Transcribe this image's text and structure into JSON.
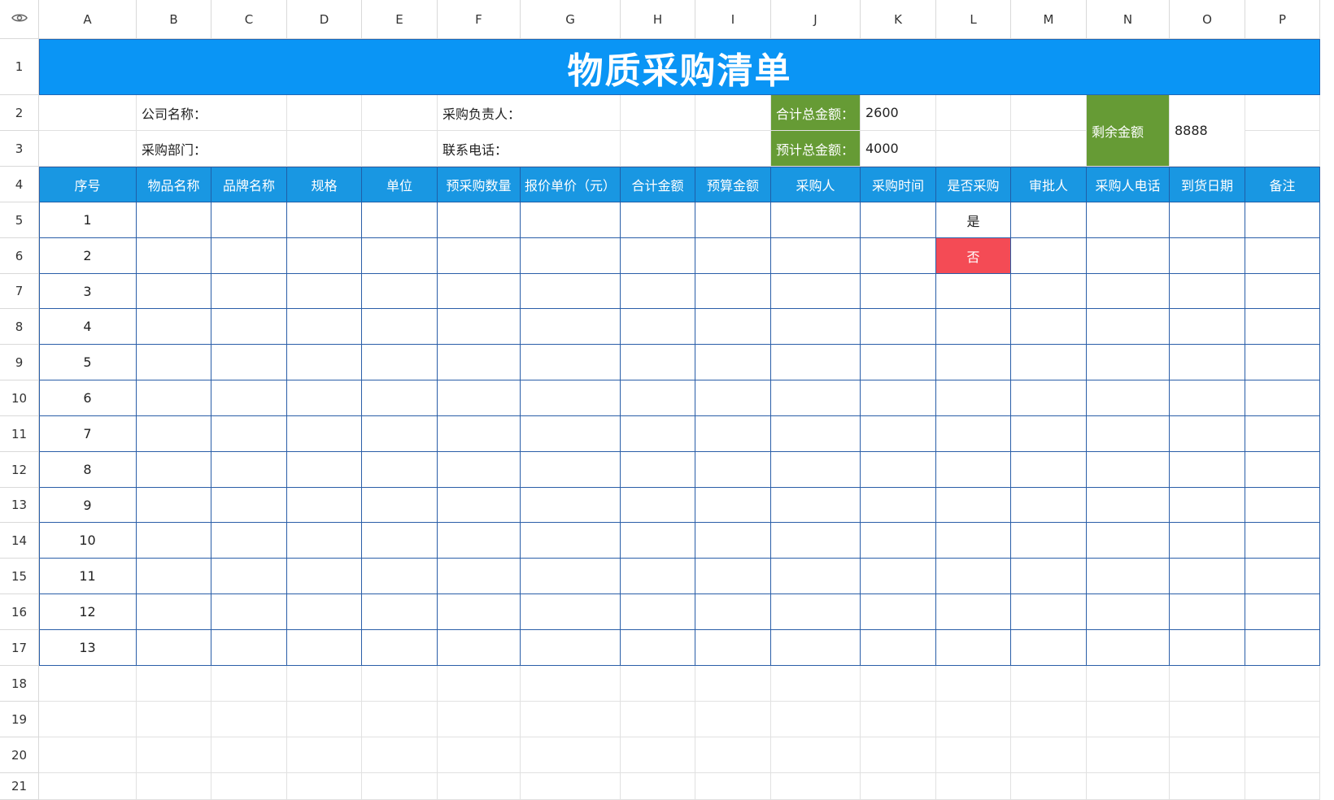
{
  "columns": [
    "A",
    "B",
    "C",
    "D",
    "E",
    "F",
    "G",
    "H",
    "I",
    "J",
    "K",
    "L",
    "M",
    "N",
    "O",
    "P"
  ],
  "rows": [
    "1",
    "2",
    "3",
    "4",
    "5",
    "6",
    "7",
    "8",
    "9",
    "10",
    "11",
    "12",
    "13",
    "14",
    "15",
    "16",
    "17",
    "18",
    "19",
    "20",
    "21"
  ],
  "title": "物质采购清单",
  "info": {
    "company_label": "公司名称：",
    "dept_label": "采购部门：",
    "manager_label": "采购负责人：",
    "phone_label": "联系电话：",
    "total_label": "合计总金额：",
    "total_value": "2600",
    "budget_label": "预计总金额：",
    "budget_value": "4000",
    "remaining_label": "剩余金额",
    "remaining_value": "8888"
  },
  "table": {
    "headers": [
      "序号",
      "物品名称",
      "品牌名称",
      "规格",
      "单位",
      "预采购数量",
      "报价单价（元）",
      "合计金额",
      "预算金额",
      "采购人",
      "采购时间",
      "是否采购",
      "审批人",
      "采购人电话",
      "到货日期",
      "备注"
    ],
    "seq": [
      "1",
      "2",
      "3",
      "4",
      "5",
      "6",
      "7",
      "8",
      "9",
      "10",
      "11",
      "12",
      "13"
    ],
    "purchase_yes": "是",
    "purchase_no": "否"
  },
  "colors": {
    "title_bg": "#0a95f5",
    "header_bg": "#1997e2",
    "label_green": "#669b35",
    "no_red": "#f44b55",
    "table_border": "#2a5ea8"
  }
}
